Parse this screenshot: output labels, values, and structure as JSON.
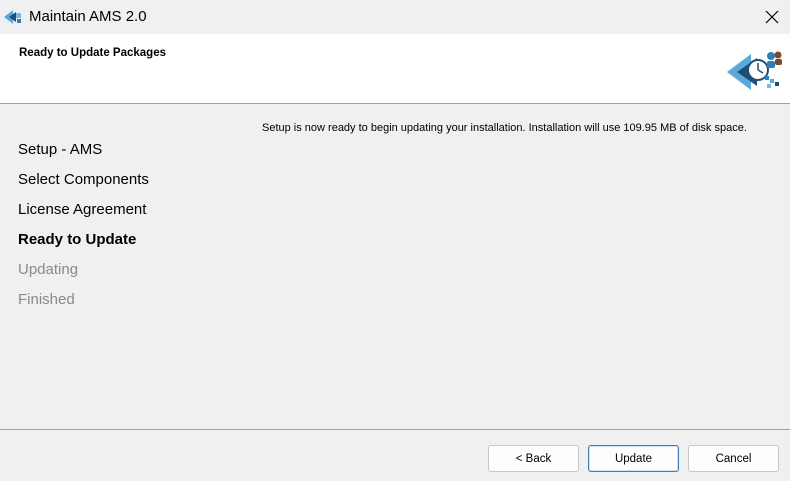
{
  "window": {
    "title": "Maintain AMS 2.0",
    "app_icon": "ams-logo-icon",
    "close_icon": "close-icon"
  },
  "header": {
    "title": "Ready to Update Packages",
    "logo_icon": "ams-logo-icon"
  },
  "steps": [
    {
      "label": "Setup - AMS",
      "state": "done"
    },
    {
      "label": "Select Components",
      "state": "done"
    },
    {
      "label": "License Agreement",
      "state": "done"
    },
    {
      "label": "Ready to Update",
      "state": "current"
    },
    {
      "label": "Updating",
      "state": "pending"
    },
    {
      "label": "Finished",
      "state": "pending"
    }
  ],
  "main": {
    "message": "Setup is now ready to begin updating your installation. Installation will use 109.95 MB of disk space."
  },
  "buttons": {
    "back": "< Back",
    "update": "Update",
    "cancel": "Cancel"
  },
  "colors": {
    "accent": "#1c86c8",
    "logo_dark": "#1e4f7a",
    "pending_text": "#8a8a8a",
    "default_button_border": "#4a7bb0"
  }
}
